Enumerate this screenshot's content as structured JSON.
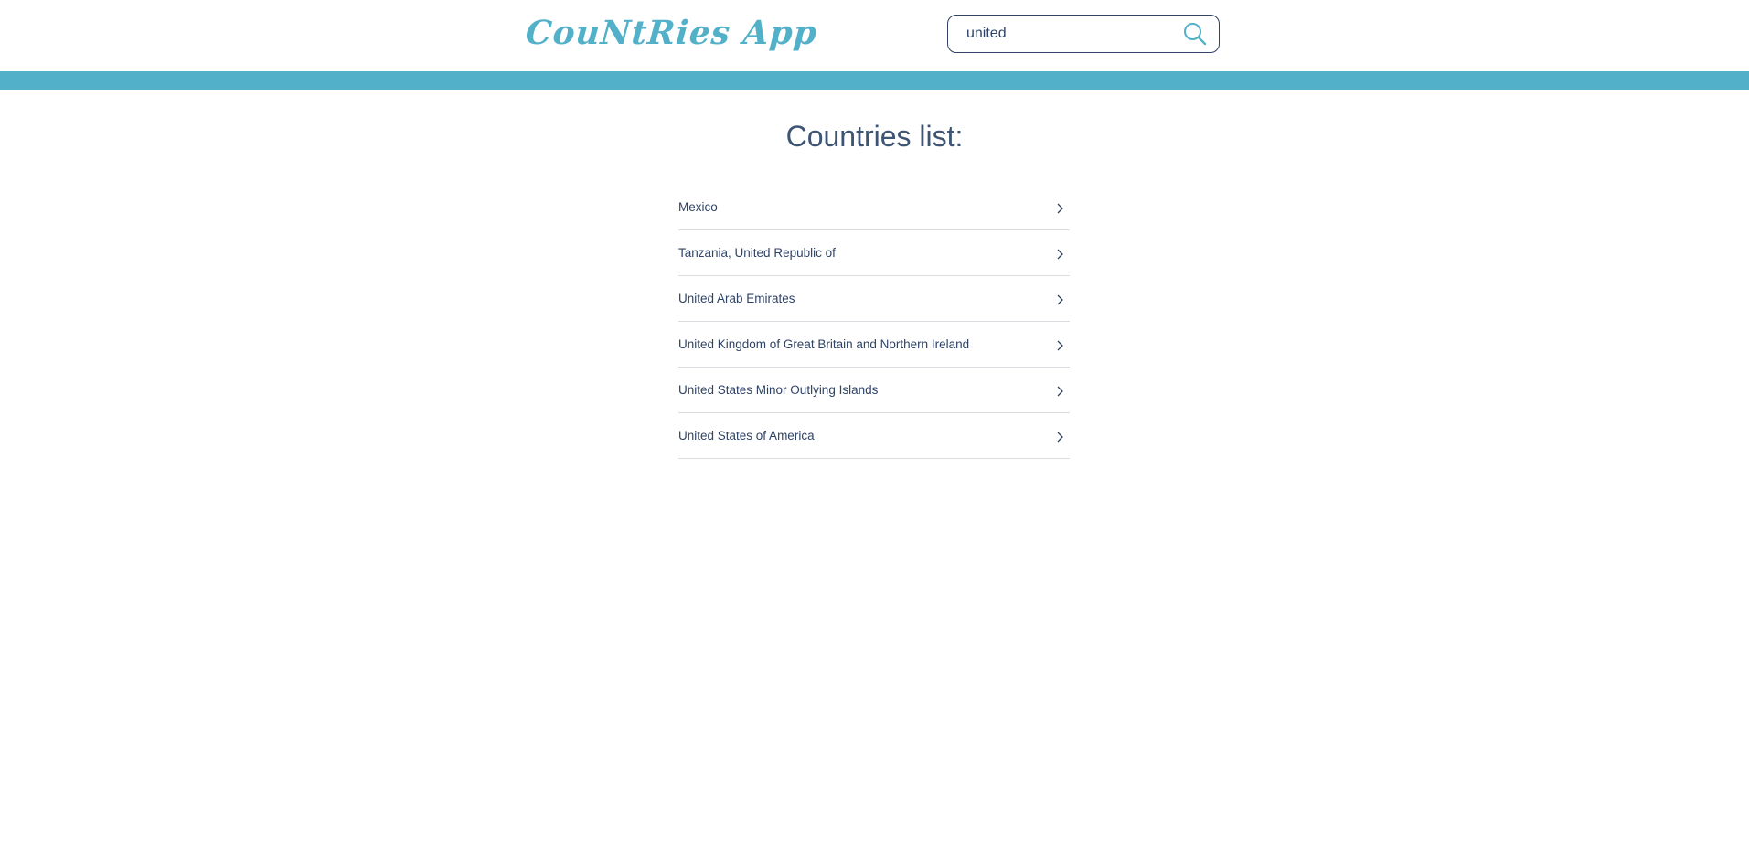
{
  "header": {
    "logo_text": "CouNtRies App",
    "search": {
      "value": "united",
      "placeholder": ""
    },
    "search_icon": "search-icon"
  },
  "main": {
    "title": "Countries list:",
    "countries": [
      {
        "name": "Mexico"
      },
      {
        "name": "Tanzania, United Republic of"
      },
      {
        "name": "United Arab Emirates"
      },
      {
        "name": "United Kingdom of Great Britain and Northern Ireland"
      },
      {
        "name": "United States Minor Outlying Islands"
      },
      {
        "name": "United States of America"
      }
    ],
    "item_icon": "chevron-right-icon"
  },
  "colors": {
    "accent": "#53b0c9",
    "text": "#2f4366",
    "divider": "#d9dde2"
  }
}
